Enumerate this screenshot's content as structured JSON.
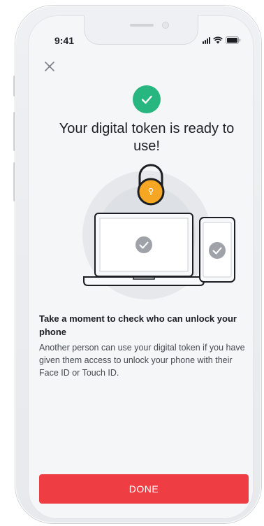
{
  "status_bar": {
    "time": "9:41"
  },
  "icons": {
    "close": "close-icon",
    "success": "check-circle-icon",
    "lock": "padlock-icon",
    "laptop": "laptop-icon",
    "phone": "phone-icon"
  },
  "colors": {
    "success": "#27b67f",
    "accent": "#ee3e44",
    "lock": "#f5a623",
    "text": "#1b1f24"
  },
  "main": {
    "title": "Your digital token is ready to use!",
    "heading": "Take a moment to check who can unlock your phone",
    "body": "Another person can use your digital token if you have given them access to unlock your phone with their Face ID or Touch ID."
  },
  "footer": {
    "done_label": "DONE"
  }
}
